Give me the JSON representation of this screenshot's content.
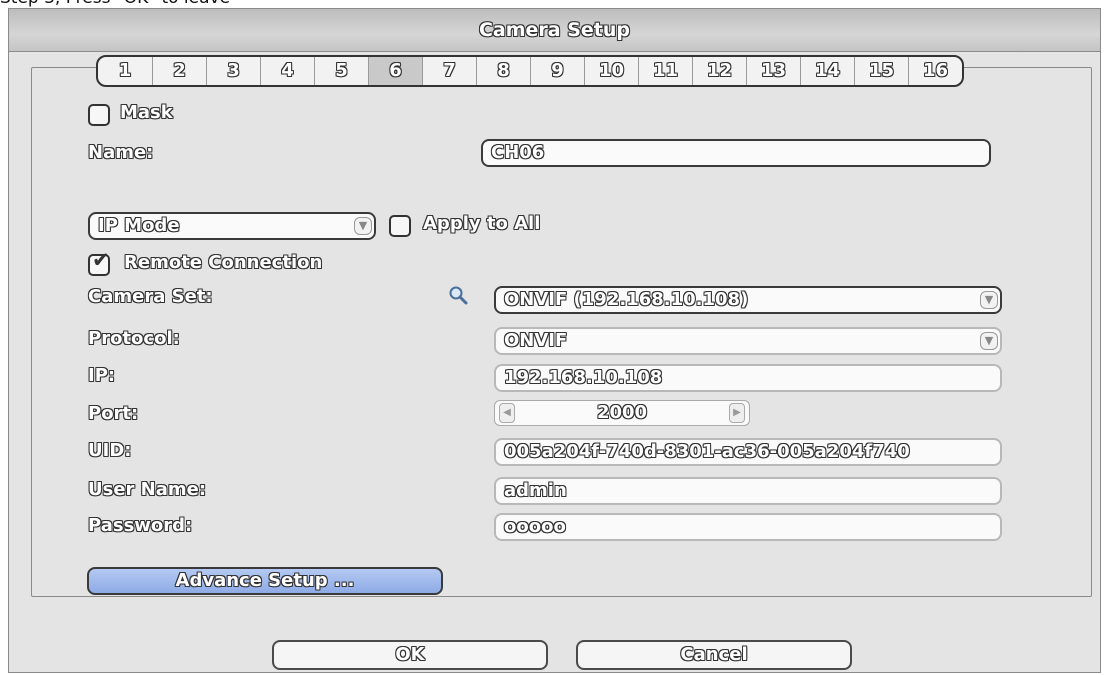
{
  "caption": "Step 3, Press \"OK\" to leave",
  "window": {
    "title": "Camera Setup"
  },
  "tabs": [
    "1",
    "2",
    "3",
    "4",
    "5",
    "6",
    "7",
    "8",
    "9",
    "10",
    "11",
    "12",
    "13",
    "14",
    "15",
    "16"
  ],
  "active_tab": "6",
  "mask": {
    "label": "Mask",
    "checked": false
  },
  "name": {
    "label": "Name:",
    "value": "CH06"
  },
  "mode": {
    "value": "IP Mode"
  },
  "apply_all": {
    "label": "Apply to All",
    "checked": false
  },
  "remote": {
    "label": "Remote Connection",
    "checked": true
  },
  "camera_set": {
    "label": "Camera Set:",
    "value": "ONVIF (192.168.10.108)"
  },
  "protocol": {
    "label": "Protocol:",
    "value": "ONVIF"
  },
  "ip": {
    "label": "IP:",
    "value": "192.168.10.108"
  },
  "port": {
    "label": "Port:",
    "value": "2000"
  },
  "uid": {
    "label": "UID:",
    "value": "005a204f-740d-8301-ac36-005a204f740"
  },
  "user": {
    "label": "User Name:",
    "value": "admin"
  },
  "password": {
    "label": "Password:",
    "value": "ooooo"
  },
  "advance_label": "Advance Setup ...",
  "ok_label": "OK",
  "cancel_label": "Cancel",
  "icons": {
    "search": "magnifier-icon",
    "dropdown": "chevron-down-icon",
    "spin_left": "arrow-left-icon",
    "spin_right": "arrow-right-icon",
    "check": "checkmark-icon"
  },
  "colors": {
    "advance_button": "#9fb8ec",
    "active_tab": "#c9c9c9",
    "window_bg": "#e4e4e4"
  }
}
